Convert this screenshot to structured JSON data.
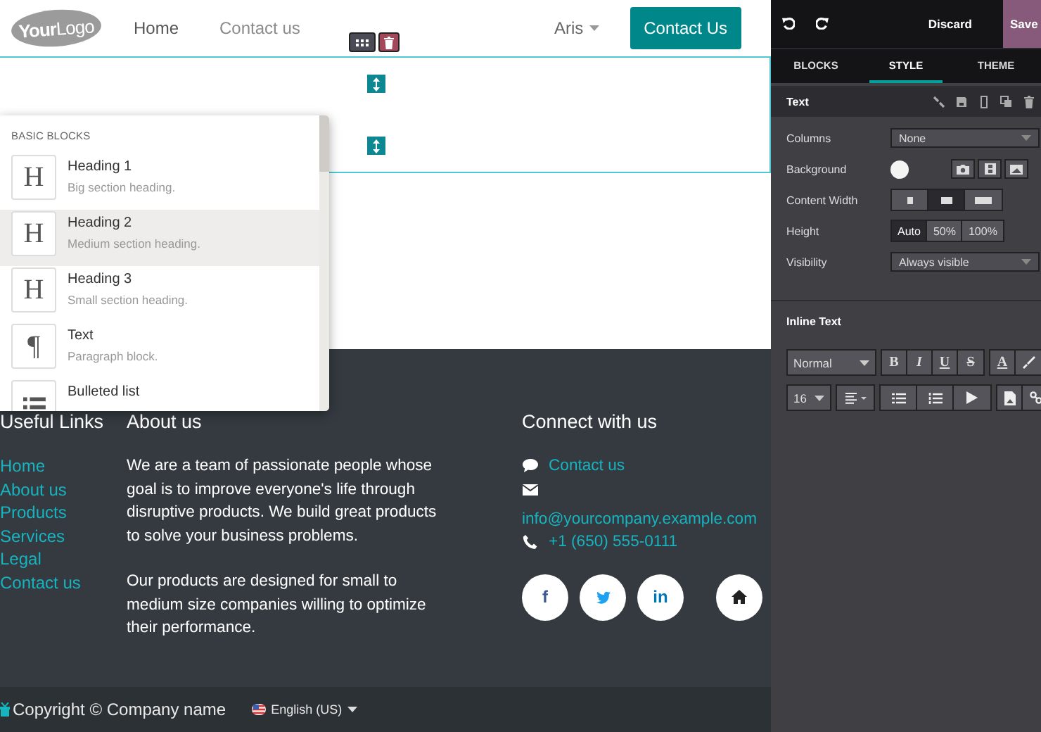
{
  "header": {
    "logo": {
      "bold": "Your",
      "light": "Logo"
    },
    "nav": [
      {
        "label": "Home",
        "selected": true
      },
      {
        "label": "Contact us",
        "selected": false
      }
    ],
    "user_menu": "Aris",
    "cta": "Contact Us"
  },
  "block_popup": {
    "section": "BASIC BLOCKS",
    "items": [
      {
        "kind": "glyph",
        "icon": "H",
        "title": "Heading 1",
        "description": "Big section heading.",
        "selected": false
      },
      {
        "kind": "glyph",
        "icon": "H",
        "title": "Heading 2",
        "description": "Medium section heading.",
        "selected": true
      },
      {
        "kind": "glyph",
        "icon": "H",
        "title": "Heading 3",
        "description": "Small section heading.",
        "selected": false
      },
      {
        "kind": "glyph",
        "icon": "¶",
        "title": "Text",
        "description": "Paragraph block.",
        "selected": false
      },
      {
        "kind": "list",
        "title": "Bulleted list",
        "selected": false
      }
    ]
  },
  "footer": {
    "useful_links": {
      "title": "Useful Links",
      "links": [
        "Home",
        "About us",
        "Products",
        "Services",
        "Legal",
        "Contact us"
      ]
    },
    "about": {
      "title": "About us",
      "paragraphs": [
        "We are a team of passionate people whose goal is to improve everyone's life through disruptive products. We build great products to solve your business problems.",
        "Our products are designed for small to medium size companies willing to optimize their performance."
      ]
    },
    "connect": {
      "title": "Connect with us",
      "contacts": [
        {
          "kind": "chat",
          "text": "Contact us"
        },
        {
          "kind": "mail",
          "text": "info@yourcompany.example.com"
        },
        {
          "kind": "phone",
          "text": "+1 (650) 555-0111"
        }
      ],
      "social": [
        {
          "kind": "glyph",
          "glyph": "f",
          "color": "#3b5998"
        },
        {
          "kind": "twitter",
          "color": "#1da1f2"
        },
        {
          "kind": "glyph",
          "glyph": "in",
          "color": "#0077b5"
        },
        {
          "kind": "home",
          "color": "#222222"
        }
      ]
    },
    "copyright": "Copyright © Company name",
    "language": "English (US)"
  },
  "editor": {
    "discard": "Discard",
    "save": "Save",
    "tabs": [
      {
        "label": "BLOCKS",
        "selected": false
      },
      {
        "label": "STYLE",
        "selected": true
      },
      {
        "label": "THEME",
        "selected": false
      }
    ],
    "section": "Text",
    "options": [
      {
        "kind": "select",
        "label": "Columns",
        "value": "None"
      },
      {
        "kind": "background",
        "label": "Background"
      },
      {
        "kind": "width",
        "label": "Content Width",
        "options": [
          {
            "selected": false
          },
          {
            "selected": true
          },
          {
            "selected": false
          }
        ]
      },
      {
        "kind": "segmented",
        "label": "Height",
        "options": [
          {
            "label": "Auto",
            "selected": true
          },
          {
            "label": "50%",
            "selected": false
          },
          {
            "label": "100%",
            "selected": false
          }
        ]
      },
      {
        "kind": "select",
        "label": "Visibility",
        "value": "Always visible"
      }
    ],
    "inline_title": "Inline Text",
    "toolbar": {
      "style": "Normal",
      "bold": "B",
      "italic": "I",
      "underline": "U",
      "strike": "S",
      "text_color": "A",
      "size": "16"
    }
  }
}
